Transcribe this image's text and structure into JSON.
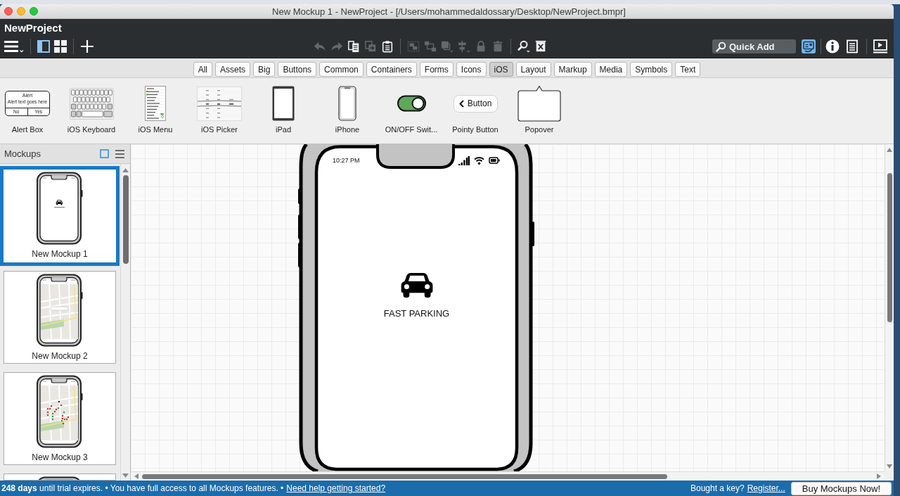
{
  "window": {
    "title": "New Mockup 1 - NewProject - [/Users/mohammedaldossary/Desktop/NewProject.bmpr]"
  },
  "project": {
    "name": "NewProject"
  },
  "toolbar": {
    "view_toggles": [
      {
        "kind": "panel",
        "selected": true
      },
      {
        "kind": "grid",
        "selected": false
      }
    ],
    "edit_groups": [
      {
        "tools": [
          {
            "kind": "undo",
            "disabled": true
          },
          {
            "kind": "redo",
            "disabled": true
          },
          {
            "kind": "copy",
            "disabled": false
          },
          {
            "kind": "duplicate",
            "disabled": true
          },
          {
            "kind": "paste",
            "disabled": false
          }
        ]
      },
      {
        "tools": [
          {
            "kind": "group",
            "disabled": true
          },
          {
            "kind": "ungroup",
            "disabled": true
          },
          {
            "kind": "arrange",
            "disabled": true
          },
          {
            "kind": "align",
            "disabled": true
          },
          {
            "kind": "lock",
            "disabled": true
          },
          {
            "kind": "delete",
            "disabled": true
          }
        ]
      },
      {
        "tools": [
          {
            "kind": "find",
            "disabled": false
          },
          {
            "kind": "clear",
            "disabled": false
          }
        ]
      }
    ],
    "quick_add": {
      "placeholder": "Quick Add"
    },
    "panel_groups": [
      {
        "tools": [
          {
            "kind": "properties",
            "selected": true
          }
        ]
      },
      {
        "tools": [
          {
            "kind": "info",
            "selected": false
          },
          {
            "kind": "notes",
            "selected": false
          }
        ]
      }
    ]
  },
  "library": {
    "categories": [
      {
        "label": "All",
        "selected": false
      },
      {
        "label": "Assets",
        "selected": false
      },
      {
        "label": "Big",
        "selected": false
      },
      {
        "label": "Buttons",
        "selected": false
      },
      {
        "label": "Common",
        "selected": false
      },
      {
        "label": "Containers",
        "selected": false
      },
      {
        "label": "Forms",
        "selected": false
      },
      {
        "label": "Icons",
        "selected": false
      },
      {
        "label": "iOS",
        "selected": true
      },
      {
        "label": "Layout",
        "selected": false
      },
      {
        "label": "Markup",
        "selected": false
      },
      {
        "label": "Media",
        "selected": false
      },
      {
        "label": "Symbols",
        "selected": false
      },
      {
        "label": "Text",
        "selected": false
      }
    ],
    "components": [
      {
        "kind": "alert",
        "label": "Alert Box",
        "title": "Alert",
        "message": "Alert text goes here",
        "buttons": [
          "No",
          "Yes"
        ]
      },
      {
        "kind": "keyboard",
        "label": "iOS Keyboard"
      },
      {
        "kind": "menu",
        "label": "iOS Menu"
      },
      {
        "kind": "picker",
        "label": "iOS Picker"
      },
      {
        "kind": "tablet",
        "label": "iPad"
      },
      {
        "kind": "phone",
        "label": "iPhone"
      },
      {
        "kind": "switch",
        "label": "ON/OFF Swit...",
        "on": true
      },
      {
        "kind": "pointy_button",
        "label": "Pointy Button",
        "button_text": "Button"
      },
      {
        "kind": "popover",
        "label": "Popover"
      }
    ]
  },
  "mockups": {
    "title": "Mockups",
    "items": [
      {
        "kind": "splash",
        "label": "New Mockup 1",
        "selected": true
      },
      {
        "kind": "map",
        "label": "New Mockup 2",
        "selected": false
      },
      {
        "kind": "map_pins",
        "label": "New Mockup 3",
        "selected": false
      },
      {
        "kind": "blank",
        "selected": false
      }
    ]
  },
  "canvas": {
    "mockup": {
      "time": "10:27 PM",
      "title": "FAST PARKING"
    }
  },
  "status_bar": {
    "message": "**248 days** until trial expires. • You have full access to all Mockups features. •",
    "help_link": "Need help getting started?",
    "key_prompt": "Bought a key?",
    "register_link": "Register...",
    "buy_button": "Buy Mockups Now!"
  }
}
